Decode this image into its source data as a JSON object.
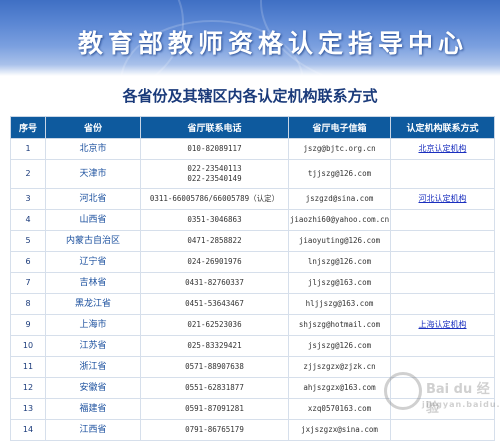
{
  "banner": {
    "title": "教育部教师资格认定指导中心"
  },
  "subtitle": "各省份及其辖区内各认定机构联系方式",
  "table": {
    "headers": [
      "序号",
      "省份",
      "省厅联系电话",
      "省厅电子信箱",
      "认定机构联系方式"
    ],
    "rows": [
      {
        "no": "1",
        "province": "北京市",
        "phone": "010-82089117",
        "phone2": "",
        "email": "jszg@bjtc.org.cn",
        "link": "北京认定机构"
      },
      {
        "no": "2",
        "province": "天津市",
        "phone": "022-23540113",
        "phone2": "022-23540149",
        "email": "tjjszg@126.com",
        "link": ""
      },
      {
        "no": "3",
        "province": "河北省",
        "phone": "0311-66005786/66005789（认定）",
        "phone2": "",
        "email": "jszgzd@sina.com",
        "link": "河北认定机构"
      },
      {
        "no": "4",
        "province": "山西省",
        "phone": "0351-3046863",
        "phone2": "",
        "email": "jiaozhi60@yahoo.com.cn",
        "link": ""
      },
      {
        "no": "5",
        "province": "内蒙古自治区",
        "phone": "0471-2858822",
        "phone2": "",
        "email": "jiaoyuting@126.com",
        "link": ""
      },
      {
        "no": "6",
        "province": "辽宁省",
        "phone": "024-26901976",
        "phone2": "",
        "email": "lnjszg@126.com",
        "link": ""
      },
      {
        "no": "7",
        "province": "吉林省",
        "phone": "0431-82760337",
        "phone2": "",
        "email": "jljszg@163.com",
        "link": ""
      },
      {
        "no": "8",
        "province": "黑龙江省",
        "phone": "0451-53643467",
        "phone2": "",
        "email": "hljjszg@163.com",
        "link": ""
      },
      {
        "no": "9",
        "province": "上海市",
        "phone": "021-62523036",
        "phone2": "",
        "email": "shjszg@hotmail.com",
        "link": "上海认定机构"
      },
      {
        "no": "10",
        "province": "江苏省",
        "phone": "025-83329421",
        "phone2": "",
        "email": "jsjszg@126.com",
        "link": ""
      },
      {
        "no": "11",
        "province": "浙江省",
        "phone": "0571-88907638",
        "phone2": "",
        "email": "zjjszgzx@zjzk.cn",
        "link": ""
      },
      {
        "no": "12",
        "province": "安徽省",
        "phone": "0551-62831877",
        "phone2": "",
        "email": "ahjszgzx@163.com",
        "link": ""
      },
      {
        "no": "13",
        "province": "福建省",
        "phone": "0591-87091281",
        "phone2": "",
        "email": "xzq0570163.com",
        "link": ""
      },
      {
        "no": "14",
        "province": "江西省",
        "phone": "0791-86765179",
        "phone2": "",
        "email": "jxjszgzx@sina.com",
        "link": ""
      }
    ]
  },
  "watermark": {
    "text": "Bai du 经验",
    "sub": "jingyan.baidu.com"
  }
}
